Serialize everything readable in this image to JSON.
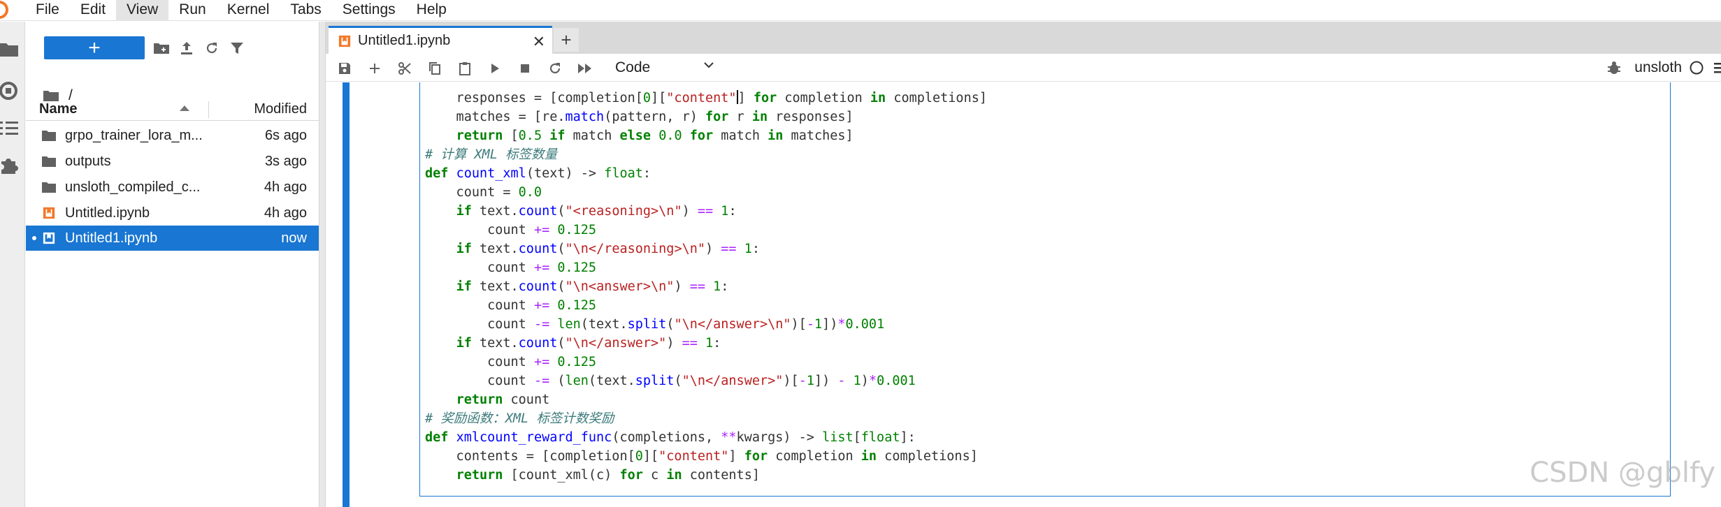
{
  "menu": [
    "File",
    "Edit",
    "View",
    "Run",
    "Kernel",
    "Tabs",
    "Settings",
    "Help"
  ],
  "menu_active": "View",
  "filebrowser": {
    "new_label": "+",
    "breadcrumb": "/",
    "header": {
      "name": "Name",
      "modified": "Modified"
    },
    "files": [
      {
        "name": "grpo_trainer_lora_m...",
        "modified": "6s ago",
        "type": "folder"
      },
      {
        "name": "outputs",
        "modified": "3s ago",
        "type": "folder"
      },
      {
        "name": "unsloth_compiled_c...",
        "modified": "4h ago",
        "type": "folder"
      },
      {
        "name": "Untitled.ipynb",
        "modified": "4h ago",
        "type": "notebook"
      },
      {
        "name": "Untitled1.ipynb",
        "modified": "now",
        "type": "notebook",
        "selected": true,
        "running": true
      }
    ]
  },
  "tabs": [
    {
      "label": "Untitled1.ipynb"
    }
  ],
  "toolbar": {
    "cell_type": "Code",
    "kernel_name": "unsloth"
  },
  "code_lines": [
    "    responses = [completion[0][\"content\"] for completion in completions]",
    "    matches = [re.match(pattern, r) for r in responses]",
    "    return [0.5 if match else 0.0 for match in matches]",
    "# 计算 XML 标签数量",
    "def count_xml(text) -> float:",
    "    count = 0.0",
    "    if text.count(\"<reasoning>\\n\") == 1:",
    "        count += 0.125",
    "    if text.count(\"\\n</reasoning>\\n\") == 1:",
    "        count += 0.125",
    "    if text.count(\"\\n<answer>\\n\") == 1:",
    "        count += 0.125",
    "        count -= len(text.split(\"\\n</answer>\\n\")[-1])*0.001",
    "    if text.count(\"\\n</answer>\") == 1:",
    "        count += 0.125",
    "        count -= (len(text.split(\"\\n</answer>\")[-1]) - 1)*0.001",
    "    return count",
    "# 奖励函数：XML 标签计数奖励",
    "def xmlcount_reward_func(completions, **kwargs) -> list[float]:",
    "    contents = [completion[0][\"content\"] for completion in completions]",
    "    return [count_xml(c) for c in contents]"
  ],
  "watermark": "CSDN @gblfy",
  "colors": {
    "accent": "#1976d2",
    "jupyter_orange": "#f37726"
  }
}
